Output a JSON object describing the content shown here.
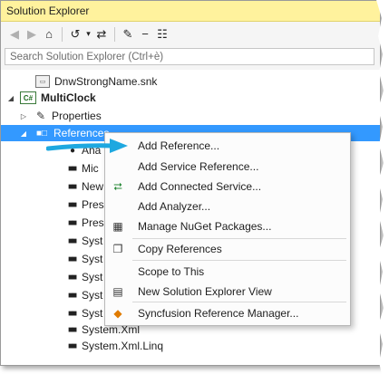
{
  "window": {
    "title": "Solution Explorer"
  },
  "toolbar": {
    "buttons": [
      {
        "icon": "back-icon",
        "glyph": "◀"
      },
      {
        "icon": "forward-icon",
        "glyph": "▶"
      },
      {
        "icon": "home-icon",
        "glyph": "⌂"
      },
      {
        "icon": "history-icon",
        "glyph": "↺"
      },
      {
        "icon": "dropdown-icon",
        "glyph": "▾"
      },
      {
        "icon": "sync-icon",
        "glyph": "⇄"
      },
      {
        "icon": "wrench-icon",
        "glyph": "✎"
      },
      {
        "icon": "collapse-icon",
        "glyph": "−"
      },
      {
        "icon": "solution-tree-icon",
        "glyph": "☷"
      }
    ]
  },
  "search": {
    "placeholder": "Search Solution Explorer (Ctrl+è)"
  },
  "tree": {
    "items": [
      {
        "label": "DnwStrongName.snk",
        "icon": "snk-file-icon"
      },
      {
        "label": "MultiClock",
        "icon": "csharp-project-icon",
        "expander": "◢"
      },
      {
        "label": "Properties",
        "icon": "wrench-icon",
        "expander": "▷"
      },
      {
        "label": "References",
        "icon": "references-icon",
        "expander": "◢",
        "selected": true
      },
      {
        "label": "Ana",
        "icon": "analyzer-icon"
      },
      {
        "label": "Mic",
        "icon": "reference-icon"
      },
      {
        "label": "New",
        "icon": "reference-icon"
      },
      {
        "label": "Pres",
        "icon": "reference-icon"
      },
      {
        "label": "Pres",
        "icon": "reference-icon"
      },
      {
        "label": "Syst",
        "icon": "reference-icon"
      },
      {
        "label": "Syst",
        "icon": "reference-icon"
      },
      {
        "label": "Syst",
        "icon": "reference-icon"
      },
      {
        "label": "Syst",
        "icon": "reference-icon"
      },
      {
        "label": "Syst",
        "icon": "reference-icon"
      },
      {
        "label": "System.Xml",
        "icon": "reference-icon"
      },
      {
        "label": "System.Xml.Linq",
        "icon": "reference-icon"
      }
    ]
  },
  "context_menu": {
    "items": [
      {
        "label": "Add Reference...",
        "icon": ""
      },
      {
        "label": "Add Service Reference...",
        "icon": ""
      },
      {
        "label": "Add Connected Service...",
        "icon": "connected-service-icon",
        "glyph": "⮂"
      },
      {
        "label": "Add Analyzer...",
        "icon": ""
      },
      {
        "label": "Manage NuGet Packages...",
        "icon": "nuget-icon",
        "glyph": "▦"
      },
      {
        "label": "Copy References",
        "icon": "copy-icon",
        "glyph": "❐"
      },
      {
        "label": "Scope to This",
        "icon": ""
      },
      {
        "label": "New Solution Explorer View",
        "icon": "new-view-icon",
        "glyph": "▤"
      },
      {
        "label": "Syncfusion Reference Manager...",
        "icon": "syncfusion-icon",
        "glyph": "◆"
      }
    ]
  },
  "colors": {
    "title_bar": "#fff29d",
    "selection": "#3399ff",
    "arrow": "#1ea8e0"
  }
}
